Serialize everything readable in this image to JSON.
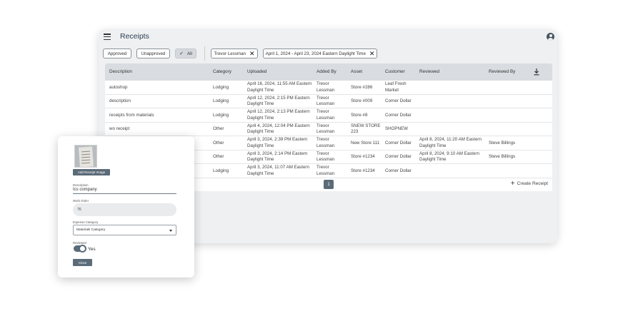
{
  "app": {
    "title": "Receipts"
  },
  "filters": {
    "approved": "Approved",
    "unapproved": "Unapproved",
    "all": "All",
    "user": "Trevor Lessman",
    "date_range": "April 1, 2024 - April 23, 2024 Eastern Daylight Time"
  },
  "table": {
    "headers": {
      "description": "Description",
      "category": "Category",
      "uploaded": "Uploaded",
      "added_by": "Added By",
      "asset": "Asset",
      "customer": "Customer",
      "reviewed": "Reviewed",
      "reviewed_by": "Reviewed By"
    },
    "rows": [
      {
        "description": "autoshop",
        "category": "Lodging",
        "uploaded": "April 16, 2024, 11:55 AM Eastern\nDaylight Time",
        "added_by": "Trevor\nLessman",
        "asset": "Store #286",
        "customer": "Leaf Fresh\nMarket",
        "reviewed": "",
        "reviewed_by": ""
      },
      {
        "description": "description",
        "category": "Lodging",
        "uploaded": "April 12, 2024, 2:15 PM Eastern\nDaylight Time",
        "added_by": "Trevor\nLessman",
        "asset": "Store #009",
        "customer": "Corner Dollar",
        "reviewed": "",
        "reviewed_by": ""
      },
      {
        "description": "receipts from materials",
        "category": "Lodging",
        "uploaded": "April 12, 2024, 2:13 PM Eastern\nDaylight Time",
        "added_by": "Trevor\nLessman",
        "asset": "Store #8",
        "customer": "Corner Dollar",
        "reviewed": "",
        "reviewed_by": ""
      },
      {
        "description": "wo receipt",
        "category": "Other",
        "uploaded": "April 4, 2024, 12:04 PM Eastern\nDaylight Time",
        "added_by": "Trevor\nLessman",
        "asset": "SNEW STORE\n223",
        "customer": "SHOPNEW",
        "reviewed": "",
        "reviewed_by": ""
      },
      {
        "description": "",
        "category": "Other",
        "uploaded": "April 3, 2024, 2:39 PM Eastern\nDaylight Time",
        "added_by": "Trevor\nLessman",
        "asset": "New Store 111",
        "customer": "Corner Dollar",
        "reviewed": "April 8, 2024, 11:20 AM Eastern\nDaylight Time",
        "reviewed_by": "Steve Billings"
      },
      {
        "description": "",
        "category": "Other",
        "uploaded": "April 3, 2024, 2:14 PM Eastern\nDaylight Time",
        "added_by": "Trevor\nLessman",
        "asset": "Store #1234",
        "customer": "Corner Dollar",
        "reviewed": "April 8, 2024, 9:10 AM Eastern\nDaylight Time",
        "reviewed_by": "Steve Billings"
      },
      {
        "description": "",
        "category": "Lodging",
        "uploaded": "April 3, 2024, 11:07 AM Eastern\nDaylight Time",
        "added_by": "Trevor\nLessman",
        "asset": "Store #1234",
        "customer": "Corner Dollar",
        "reviewed": "",
        "reviewed_by": ""
      }
    ]
  },
  "pagination": {
    "current": "1"
  },
  "actions": {
    "create": "Create Receipt"
  },
  "dialog": {
    "add_image": "Add Receipt Image",
    "description_label": "Description",
    "description_value": "Ics company",
    "work_order_label": "Work Order",
    "work_order_value": "76",
    "expense_category_label": "Expense Category",
    "expense_category_value": "Materials Category",
    "reviewed_label": "Reviewed",
    "reviewed_toggle": "Yes",
    "close": "Close"
  },
  "icons": [
    "menu-icon",
    "account-icon",
    "check-icon",
    "close-icon",
    "download-icon",
    "plus-icon",
    "caret-down-icon"
  ],
  "colors": {
    "primary": "#5b6b78",
    "panel": "#eef0f2",
    "header": "#d9dde1"
  }
}
